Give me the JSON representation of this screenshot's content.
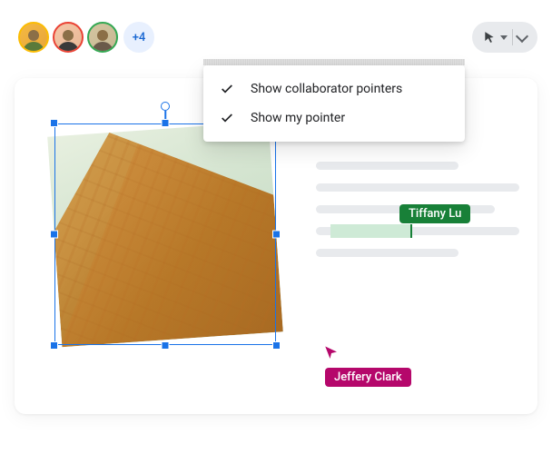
{
  "collaborators": {
    "more_count": "+4",
    "cursors": [
      {
        "name": "Tiffany Lu",
        "color": "#188038"
      },
      {
        "name": "Jeffery Clark",
        "color": "#b5076b"
      }
    ]
  },
  "menu": {
    "items": [
      {
        "label": "Show collaborator pointers",
        "checked": true
      },
      {
        "label": "Show my pointer",
        "checked": true
      }
    ]
  },
  "toolbar": {
    "active_tool": "cursor"
  }
}
